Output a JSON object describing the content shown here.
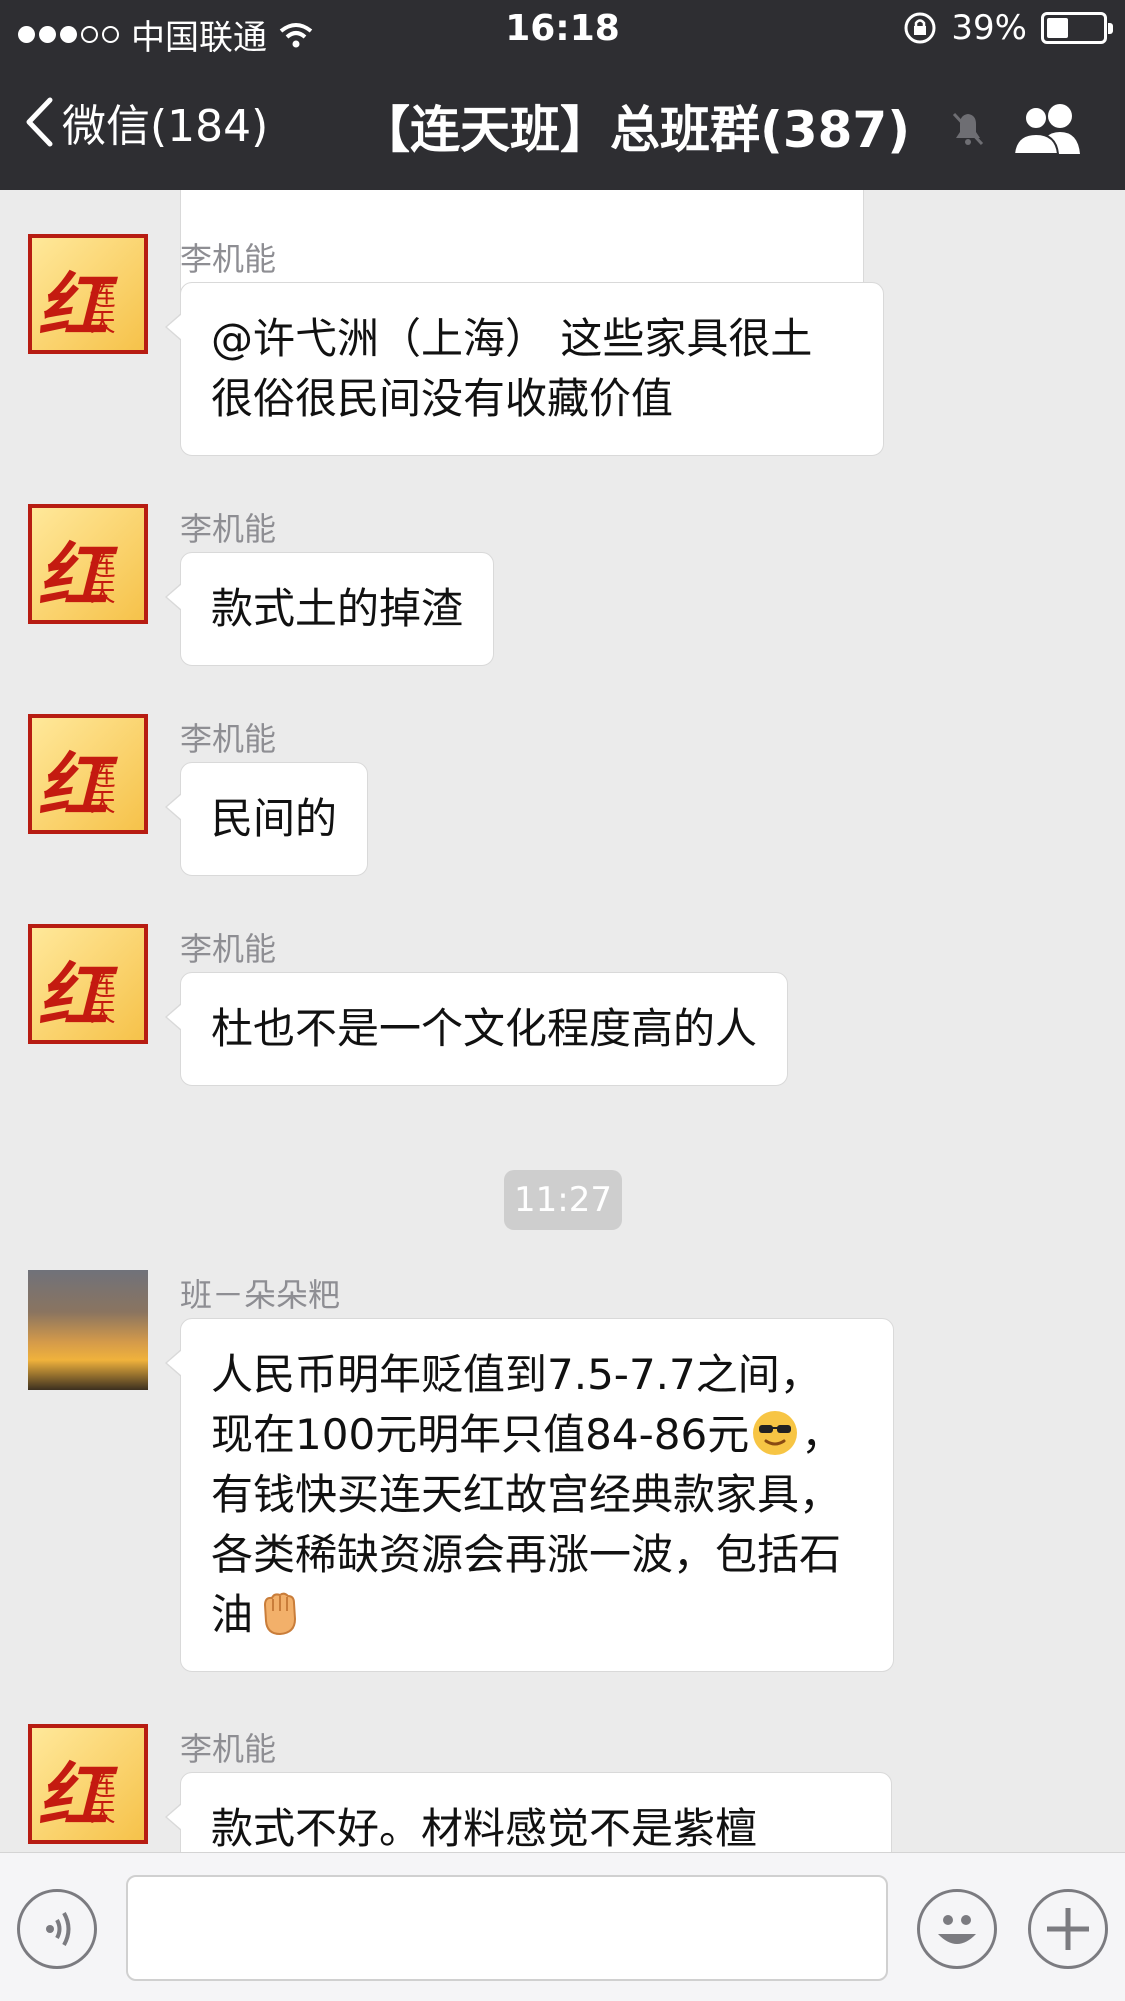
{
  "status_bar": {
    "carrier": "中国联通",
    "time": "16:18",
    "battery_percent": "39%",
    "battery_level": 0.39
  },
  "nav": {
    "back_label": "微信(184)",
    "title": "【连天班】总班群(387)"
  },
  "messages": [
    {
      "sender": "李机能",
      "text": "@许弋洲（上海） 这些家具很土很俗很民间没有收藏价值"
    },
    {
      "sender": "李机能",
      "text": "款式土的掉渣"
    },
    {
      "sender": "李机能",
      "text": "民间的"
    },
    {
      "sender": "李机能",
      "text": "杜也不是一个文化程度高的人"
    },
    {
      "timestamp": "11:27"
    },
    {
      "sender": "班－朵朵粑",
      "text_parts": [
        "人民币明年贬值到7.5-7.7之间，现在100元明年只值84-86元",
        "，有钱快买连天红故宫经典款家具，各类稀缺资源会再涨一波，包括石油"
      ],
      "emojis": [
        "sunglasses-emoji",
        "fist-emoji"
      ]
    },
    {
      "sender": "李机能",
      "text": "款式不好。材料感觉不是紫檀"
    }
  ],
  "avatar_text": {
    "big": "红",
    "small": "连天"
  },
  "icons": {
    "back": "chevron-left-icon",
    "mute": "bell-slash-icon",
    "group": "group-members-icon",
    "voice": "voice-icon",
    "emoji": "emoji-icon",
    "add": "plus-icon"
  },
  "colors": {
    "nav_bg": "#2e2e32",
    "chat_bg": "#ebebeb",
    "bubble_bg": "#ffffff",
    "avatar_red": "#b71c12",
    "avatar_gold": "#f6c24a"
  }
}
